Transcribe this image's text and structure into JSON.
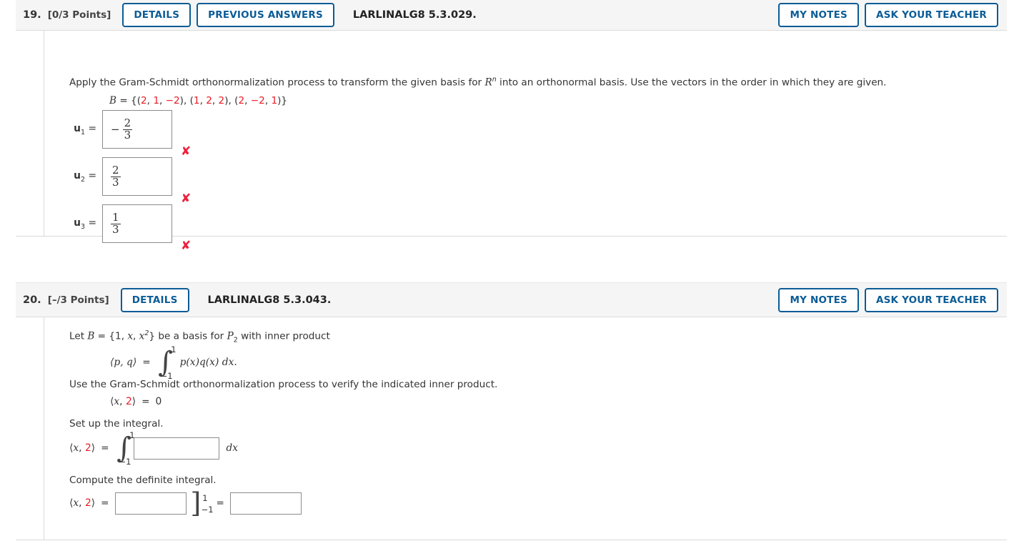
{
  "colors": {
    "accent_blue": "#0b5c96",
    "error_red": "#f01e3c",
    "answer_red": "#e81c24",
    "header_bg": "#f5f5f5",
    "border_grey": "#d9d9d9"
  },
  "problems": [
    {
      "number": "19.",
      "points": "[0/3 Points]",
      "code": "LARLINALG8 5.3.029.",
      "buttons_left": [
        "DETAILS",
        "PREVIOUS ANSWERS"
      ],
      "buttons_right": [
        "MY NOTES",
        "ASK YOUR TEACHER"
      ],
      "statement": {
        "part1": "Apply the Gram-Schmidt orthonormalization process to transform the given basis for ",
        "var": "R",
        "exponent": "n",
        "part2": " into an orthonormal basis. Use the vectors in the order in which they are given."
      },
      "basis": {
        "label": "B",
        "equals": "=",
        "open": "{(",
        "vectors": [
          {
            "values": [
              "2",
              "1",
              "−2"
            ]
          },
          {
            "values": [
              "1",
              "2",
              "2"
            ]
          },
          {
            "values": [
              "2",
              "−2",
              "1"
            ]
          }
        ],
        "close": ")}"
      },
      "answers": [
        {
          "label": "u",
          "index": "1",
          "equals": "=",
          "sign": "−",
          "numerator": "2",
          "denominator": "3",
          "mark": "✘"
        },
        {
          "label": "u",
          "index": "2",
          "equals": "=",
          "sign": "",
          "numerator": "2",
          "denominator": "3",
          "mark": "✘"
        },
        {
          "label": "u",
          "index": "3",
          "equals": "=",
          "sign": "",
          "numerator": "1",
          "denominator": "3",
          "mark": "✘"
        }
      ]
    },
    {
      "number": "20.",
      "points": "[–/3 Points]",
      "code": "LARLINALG8 5.3.043.",
      "buttons_left": [
        "DETAILS"
      ],
      "buttons_right": [
        "MY NOTES",
        "ASK YOUR TEACHER"
      ],
      "line1": {
        "pre": "Let ",
        "B": "B",
        "eq": " = {1, ",
        "x": "x",
        "comma": ", ",
        "x2": "x",
        "sup": "2",
        "post": "} be a basis for ",
        "P": "P",
        "Psub": "2",
        "tail": " with inner product"
      },
      "inner_product_def": {
        "left": "⟨p, q⟩",
        "equals": "=",
        "upper": "1",
        "lower": "−1",
        "integrand": "p(x)q(x) dx."
      },
      "line2": "Use the Gram-Schmidt orthonormalization process to verify the indicated inner product.",
      "verify": {
        "open": "⟨",
        "x": "x",
        "comma": ", ",
        "value": "2",
        "close": "⟩",
        "equals": "=",
        "result": "0"
      },
      "setup_label": "Set up the integral.",
      "setup_row": {
        "open": "⟨",
        "x": "x",
        "comma": ", ",
        "value": "2",
        "close": "⟩",
        "equals": "=",
        "upper": "1",
        "lower": "−1",
        "input_value": "",
        "trailing": "dx"
      },
      "compute_label": "Compute the definite integral.",
      "compute_row": {
        "open": "⟨",
        "x": "x",
        "comma": ", ",
        "value": "2",
        "close": "⟩",
        "equals": "=",
        "antiderivative_value": "",
        "bracket_upper": "1",
        "bracket_lower": "−1",
        "equals2": "=",
        "result_value": ""
      }
    }
  ]
}
